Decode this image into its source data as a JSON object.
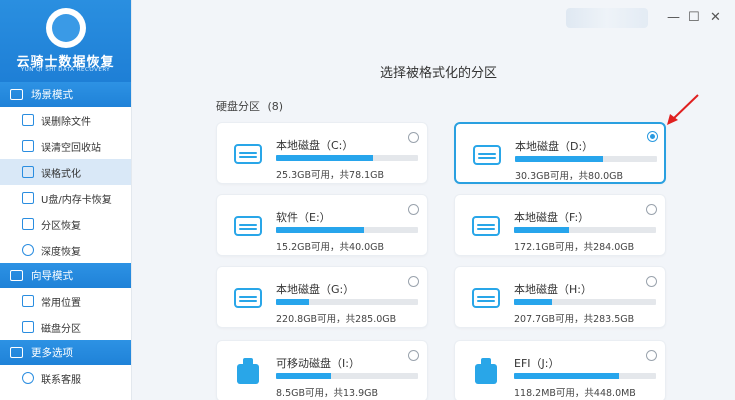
{
  "app": {
    "name": "云骑士数据恢复",
    "subtitle": "YUN QI SHI DATA RECOVERY"
  },
  "sidebar": {
    "sections": [
      {
        "title": "场景模式",
        "items": [
          {
            "label": "误删除文件",
            "icon": "trash-icon"
          },
          {
            "label": "误清空回收站",
            "icon": "recycle-bin-icon"
          },
          {
            "label": "误格式化",
            "icon": "format-icon",
            "active": true
          },
          {
            "label": "U盘/内存卡恢复",
            "icon": "usb-card-icon"
          },
          {
            "label": "分区恢复",
            "icon": "partition-icon"
          },
          {
            "label": "深度恢复",
            "icon": "deep-scan-icon"
          }
        ]
      },
      {
        "title": "向导模式",
        "items": [
          {
            "label": "常用位置",
            "icon": "common-location-icon"
          },
          {
            "label": "磁盘分区",
            "icon": "disk-partition-icon"
          }
        ]
      },
      {
        "title": "更多选项",
        "items": [
          {
            "label": "联系客服",
            "icon": "customer-service-icon"
          }
        ]
      }
    ]
  },
  "window": {
    "minimize": "—",
    "maximize": "☐",
    "close": "✕"
  },
  "main": {
    "title": "选择被格式化的分区",
    "section_label": "硬盘分区",
    "section_count": "(8)",
    "partitions": [
      {
        "name": "本地磁盘（C:）",
        "stats": "25.3GB可用，共78.1GB",
        "used": 0.68,
        "type": "hdd",
        "selected": false
      },
      {
        "name": "本地磁盘（D:）",
        "stats": "30.3GB可用，共80.0GB",
        "used": 0.62,
        "type": "hdd",
        "selected": true
      },
      {
        "name": "软件（E:）",
        "stats": "15.2GB可用，共40.0GB",
        "used": 0.62,
        "type": "hdd",
        "selected": false
      },
      {
        "name": "本地磁盘（F:）",
        "stats": "172.1GB可用，共284.0GB",
        "used": 0.39,
        "type": "hdd",
        "selected": false
      },
      {
        "name": "本地磁盘（G:）",
        "stats": "220.8GB可用，共285.0GB",
        "used": 0.23,
        "type": "hdd",
        "selected": false
      },
      {
        "name": "本地磁盘（H:）",
        "stats": "207.7GB可用，共283.5GB",
        "used": 0.27,
        "type": "hdd",
        "selected": false
      },
      {
        "name": "可移动磁盘（I:）",
        "stats": "8.5GB可用，共13.9GB",
        "used": 0.39,
        "type": "usb",
        "selected": false
      },
      {
        "name": "EFI（J:）",
        "stats": "118.2MB可用，共448.0MB",
        "used": 0.74,
        "type": "usb",
        "selected": false
      }
    ]
  },
  "colors": {
    "accent": "#1f82d8",
    "bar_fill": "#27a5ec",
    "selected_border": "#2aa0e0",
    "arrow": "#e02020"
  }
}
